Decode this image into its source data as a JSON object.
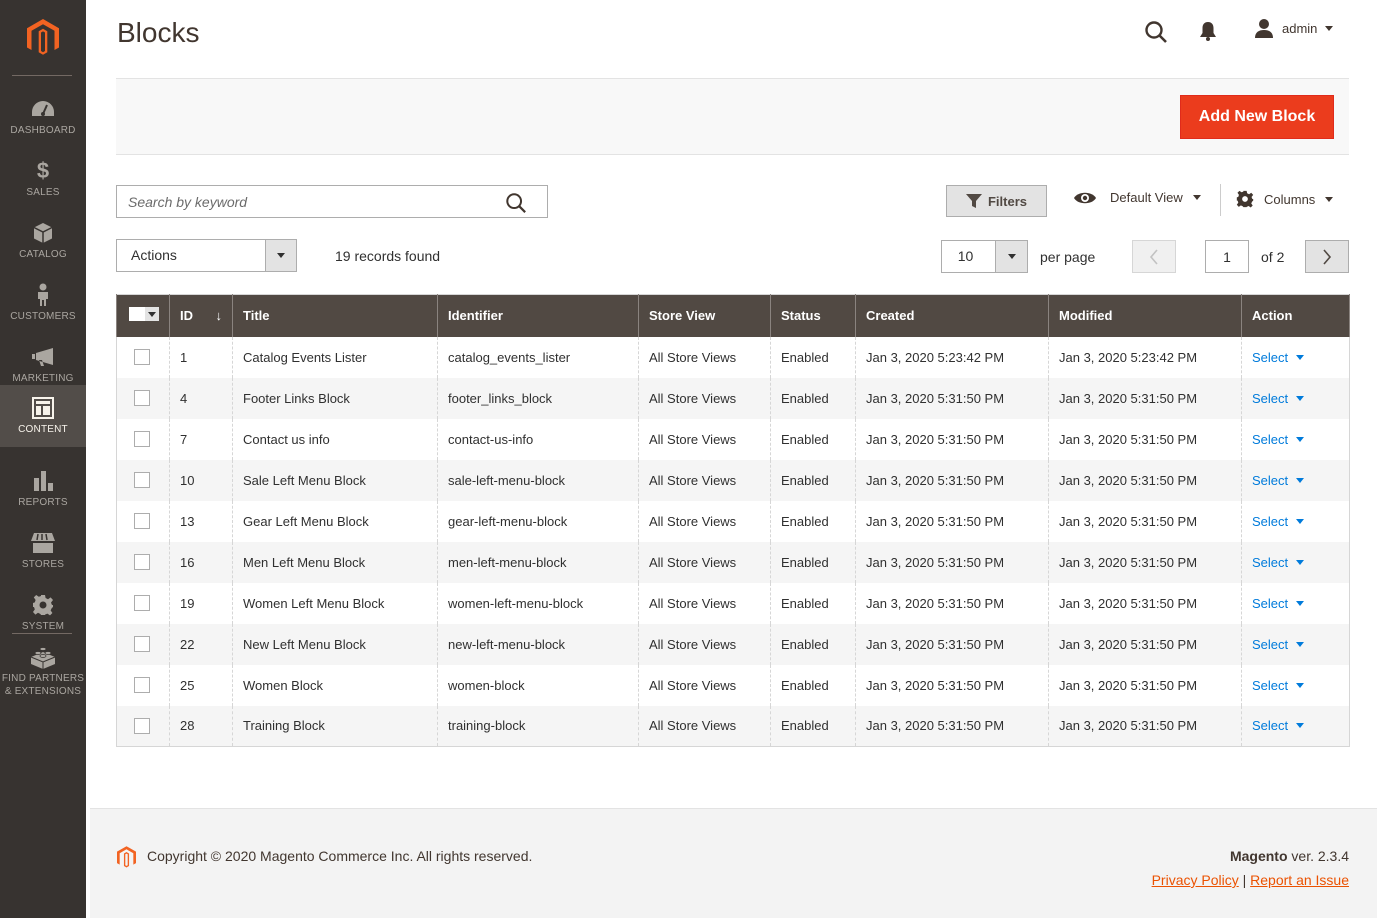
{
  "sidebar": {
    "items": [
      {
        "key": "dashboard",
        "label": "DASHBOARD",
        "icon": "dashboard-icon"
      },
      {
        "key": "sales",
        "label": "SALES",
        "icon": "dollar-icon"
      },
      {
        "key": "catalog",
        "label": "CATALOG",
        "icon": "box-icon"
      },
      {
        "key": "customers",
        "label": "CUSTOMERS",
        "icon": "person-icon"
      },
      {
        "key": "marketing",
        "label": "MARKETING",
        "icon": "megaphone-icon"
      },
      {
        "key": "content",
        "label": "CONTENT",
        "icon": "layout-icon",
        "active": true
      },
      {
        "key": "reports",
        "label": "REPORTS",
        "icon": "bar-chart-icon"
      },
      {
        "key": "stores",
        "label": "STORES",
        "icon": "storefront-icon"
      },
      {
        "key": "system",
        "label": "SYSTEM",
        "icon": "gear-icon"
      },
      {
        "key": "partners",
        "label": "FIND PARTNERS & EXTENSIONS",
        "icon": "lego-brick-icon"
      }
    ]
  },
  "header": {
    "title": "Blocks",
    "user": "admin"
  },
  "action_bar": {
    "add_button": "Add New Block"
  },
  "toolbar": {
    "search_placeholder": "Search by keyword",
    "filters_label": "Filters",
    "view_label": "Default View",
    "columns_label": "Columns",
    "actions_label": "Actions",
    "records_found": "19 records found",
    "per_page_value": "10",
    "per_page_label": "per page",
    "current_page": "1",
    "total_pages_label": "of 2"
  },
  "table": {
    "headers": [
      "ID",
      "Title",
      "Identifier",
      "Store View",
      "Status",
      "Created",
      "Modified",
      "Action"
    ],
    "sort_indicator": "↓",
    "action_label": "Select",
    "rows": [
      {
        "id": "1",
        "title": "Catalog Events Lister",
        "identifier": "catalog_events_lister",
        "store_view": "All Store Views",
        "status": "Enabled",
        "created": "Jan 3, 2020 5:23:42 PM",
        "modified": "Jan 3, 2020 5:23:42 PM"
      },
      {
        "id": "4",
        "title": "Footer Links Block",
        "identifier": "footer_links_block",
        "store_view": "All Store Views",
        "status": "Enabled",
        "created": "Jan 3, 2020 5:31:50 PM",
        "modified": "Jan 3, 2020 5:31:50 PM"
      },
      {
        "id": "7",
        "title": "Contact us info",
        "identifier": "contact-us-info",
        "store_view": "All Store Views",
        "status": "Enabled",
        "created": "Jan 3, 2020 5:31:50 PM",
        "modified": "Jan 3, 2020 5:31:50 PM"
      },
      {
        "id": "10",
        "title": "Sale Left Menu Block",
        "identifier": "sale-left-menu-block",
        "store_view": "All Store Views",
        "status": "Enabled",
        "created": "Jan 3, 2020 5:31:50 PM",
        "modified": "Jan 3, 2020 5:31:50 PM"
      },
      {
        "id": "13",
        "title": "Gear Left Menu Block",
        "identifier": "gear-left-menu-block",
        "store_view": "All Store Views",
        "status": "Enabled",
        "created": "Jan 3, 2020 5:31:50 PM",
        "modified": "Jan 3, 2020 5:31:50 PM"
      },
      {
        "id": "16",
        "title": "Men Left Menu Block",
        "identifier": "men-left-menu-block",
        "store_view": "All Store Views",
        "status": "Enabled",
        "created": "Jan 3, 2020 5:31:50 PM",
        "modified": "Jan 3, 2020 5:31:50 PM"
      },
      {
        "id": "19",
        "title": "Women Left Menu Block",
        "identifier": "women-left-menu-block",
        "store_view": "All Store Views",
        "status": "Enabled",
        "created": "Jan 3, 2020 5:31:50 PM",
        "modified": "Jan 3, 2020 5:31:50 PM"
      },
      {
        "id": "22",
        "title": "New Left Menu Block",
        "identifier": "new-left-menu-block",
        "store_view": "All Store Views",
        "status": "Enabled",
        "created": "Jan 3, 2020 5:31:50 PM",
        "modified": "Jan 3, 2020 5:31:50 PM"
      },
      {
        "id": "25",
        "title": "Women Block",
        "identifier": "women-block",
        "store_view": "All Store Views",
        "status": "Enabled",
        "created": "Jan 3, 2020 5:31:50 PM",
        "modified": "Jan 3, 2020 5:31:50 PM"
      },
      {
        "id": "28",
        "title": "Training Block",
        "identifier": "training-block",
        "store_view": "All Store Views",
        "status": "Enabled",
        "created": "Jan 3, 2020 5:31:50 PM",
        "modified": "Jan 3, 2020 5:31:50 PM"
      }
    ]
  },
  "footer": {
    "copyright": "Copyright © 2020 Magento Commerce Inc. All rights reserved.",
    "brand": "Magento",
    "version": " ver. 2.3.4",
    "privacy": "Privacy Policy",
    "separator": "|",
    "report": "Report an Issue"
  },
  "colors": {
    "accent": "#eb5202",
    "button": "#eb3c1d",
    "sidebar": "#373330",
    "table_header": "#514943",
    "link": "#007bdb"
  }
}
